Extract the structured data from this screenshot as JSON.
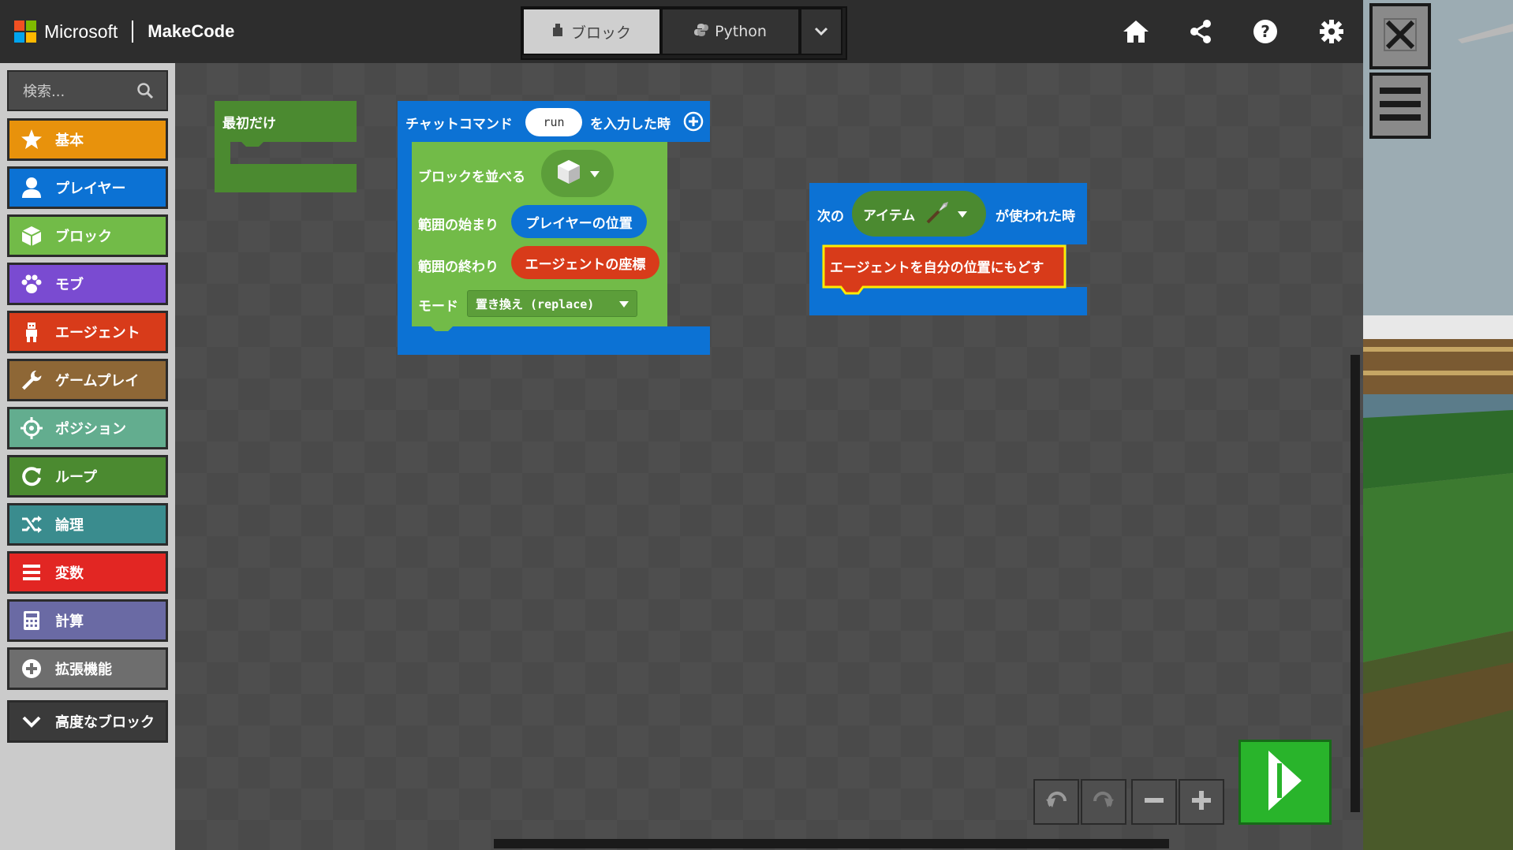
{
  "header": {
    "brand_microsoft": "Microsoft",
    "brand_product": "MakeCode",
    "mode_blocks_label": "ブロック",
    "mode_python_label": "Python",
    "icons": [
      "home-icon",
      "share-icon",
      "help-icon",
      "settings-icon"
    ]
  },
  "sidebar": {
    "search_placeholder": "検索...",
    "categories": [
      {
        "label": "基本",
        "color": "#e8920c",
        "icon": "star-icon"
      },
      {
        "label": "プレイヤー",
        "color": "#0c72d4",
        "icon": "person-icon"
      },
      {
        "label": "ブロック",
        "color": "#72bb48",
        "icon": "cube-icon"
      },
      {
        "label": "モブ",
        "color": "#7a4bd1",
        "icon": "paw-icon"
      },
      {
        "label": "エージェント",
        "color": "#d83b1a",
        "icon": "agent-icon"
      },
      {
        "label": "ゲームプレイ",
        "color": "#8e6736",
        "icon": "wrench-icon"
      },
      {
        "label": "ポジション",
        "color": "#63ad8f",
        "icon": "crosshair-icon"
      },
      {
        "label": "ループ",
        "color": "#4b8a30",
        "icon": "refresh-icon"
      },
      {
        "label": "論理",
        "color": "#3a8c8e",
        "icon": "shuffle-icon"
      },
      {
        "label": "変数",
        "color": "#e22623",
        "icon": "list-icon"
      },
      {
        "label": "計算",
        "color": "#6a6aa4",
        "icon": "calculator-icon"
      },
      {
        "label": "拡張機能",
        "color": "#6e6e6e",
        "icon": "plus-circle-icon"
      }
    ],
    "advanced_label": "高度なブロック"
  },
  "workspace": {
    "on_start": {
      "label": "最初だけ"
    },
    "chat_command": {
      "prefix": "チャットコマンド",
      "command": "run",
      "suffix": "を入力した時",
      "fill_label": "ブロックを並べる",
      "from_label": "範囲の始まり",
      "from_value": "プレイヤーの位置",
      "to_label": "範囲の終わり",
      "to_value": "エージェントの座標",
      "mode_label": "モード",
      "mode_value": "置き換え (replace)"
    },
    "item_used": {
      "prefix": "次の",
      "item": "アイテム",
      "suffix": "が使われた時",
      "action": "エージェントを自分の位置にもどす"
    }
  }
}
